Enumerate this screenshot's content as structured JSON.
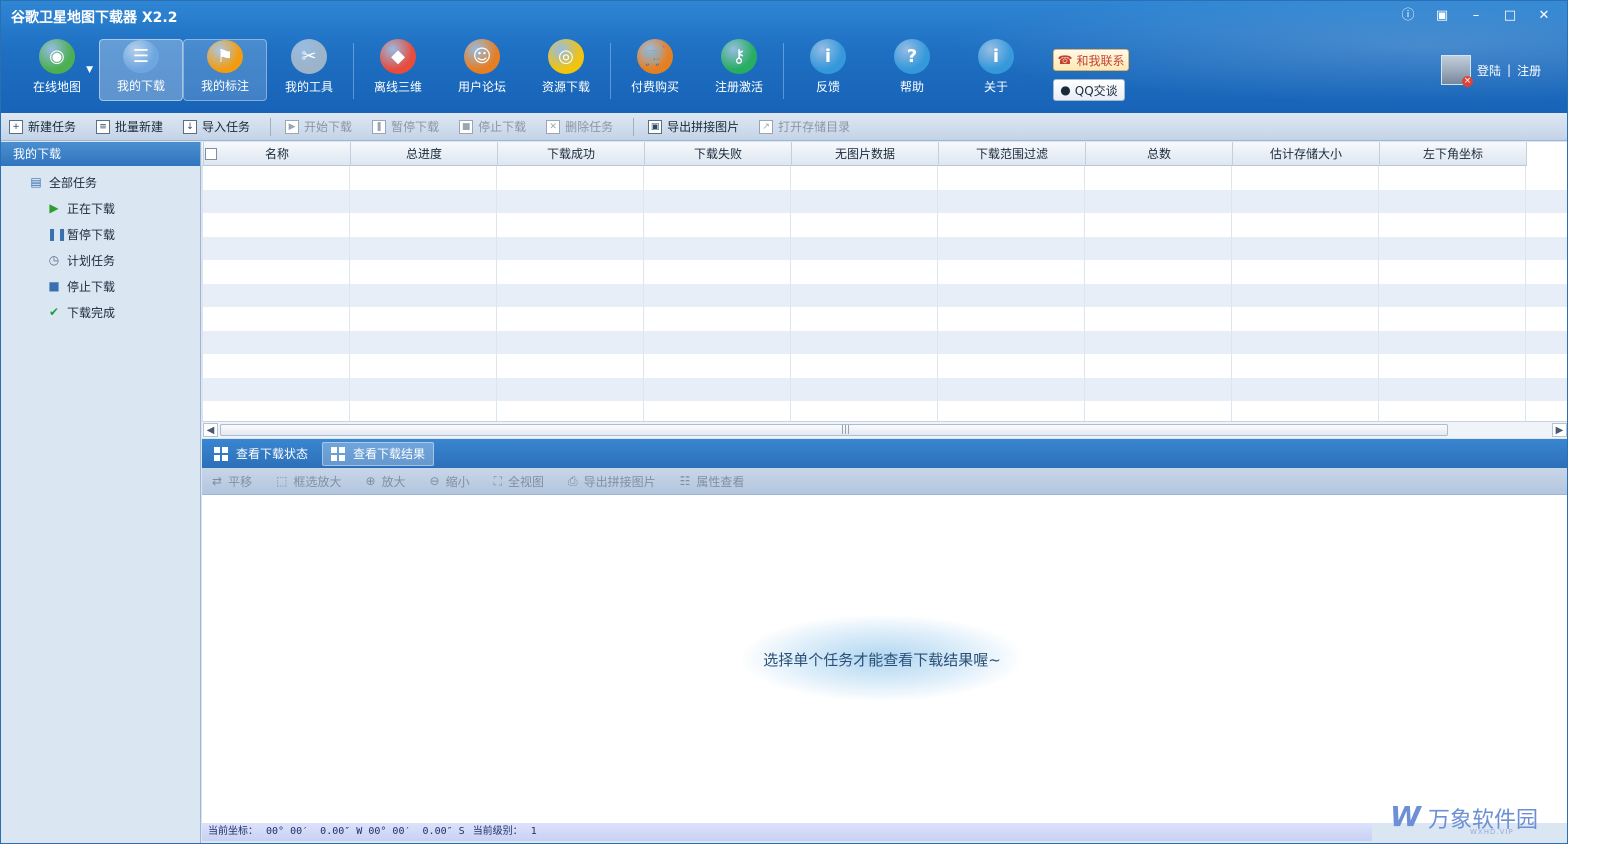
{
  "window": {
    "title": "谷歌卫星地图下载器 X2.2",
    "controls": [
      "ⓘ",
      "▣",
      "–",
      "□",
      "✕"
    ]
  },
  "main_toolbar": [
    {
      "label": "在线地图",
      "icon": "globe-icon",
      "color": "#4caf50"
    },
    {
      "label": "我的下载",
      "icon": "download-list-icon",
      "color": "#6ea6e0"
    },
    {
      "label": "我的标注",
      "icon": "map-pin-icon",
      "color": "#f39c12"
    },
    {
      "label": "我的工具",
      "icon": "tools-icon",
      "color": "#9db3c9"
    },
    {
      "label": "离线三维",
      "icon": "cubes-icon",
      "color": "#e74c3c"
    },
    {
      "label": "用户论坛",
      "icon": "users-icon",
      "color": "#e67e22"
    },
    {
      "label": "资源下载",
      "icon": "resource-globe-icon",
      "color": "#f1c40f"
    },
    {
      "label": "付费购买",
      "icon": "cart-icon",
      "color": "#e67e22"
    },
    {
      "label": "注册激活",
      "icon": "lock-globe-icon",
      "color": "#27ae60"
    },
    {
      "label": "反馈",
      "icon": "feedback-icon",
      "color": "#3498db"
    },
    {
      "label": "帮助",
      "icon": "help-icon",
      "color": "#3498db"
    },
    {
      "label": "关于",
      "icon": "info-icon",
      "color": "#3498db"
    }
  ],
  "contact": {
    "contact_us": "和我联系",
    "qq_chat": "QQ交谈"
  },
  "account": {
    "login": "登陆",
    "separator": "|",
    "register": "注册"
  },
  "task_toolbar": [
    {
      "label": "新建任务",
      "enabled": true,
      "icon": "new-task-icon"
    },
    {
      "label": "批量新建",
      "enabled": true,
      "icon": "batch-new-icon"
    },
    {
      "label": "导入任务",
      "enabled": true,
      "icon": "import-icon"
    },
    {
      "label": "开始下载",
      "enabled": false,
      "icon": "play-icon"
    },
    {
      "label": "暂停下载",
      "enabled": false,
      "icon": "pause-icon"
    },
    {
      "label": "停止下载",
      "enabled": false,
      "icon": "stop-icon"
    },
    {
      "label": "删除任务",
      "enabled": false,
      "icon": "delete-icon"
    },
    {
      "label": "导出拼接图片",
      "enabled": true,
      "icon": "export-image-icon"
    },
    {
      "label": "打开存储目录",
      "enabled": false,
      "icon": "open-folder-icon"
    }
  ],
  "sidebar": {
    "header": "我的下载",
    "root": {
      "label": "全部任务",
      "icon": "list-icon"
    },
    "items": [
      {
        "label": "正在下载",
        "icon": "play-icon",
        "glyph": "▶",
        "color": "#2e9d2e"
      },
      {
        "label": "暂停下载",
        "icon": "pause-icon",
        "glyph": "❚❚",
        "color": "#3a6fb0"
      },
      {
        "label": "计划任务",
        "icon": "clock-icon",
        "glyph": "◷",
        "color": "#5a6e85"
      },
      {
        "label": "停止下载",
        "icon": "stop-icon",
        "glyph": "■",
        "color": "#3a6fb0"
      },
      {
        "label": "下载完成",
        "icon": "check-icon",
        "glyph": "✔",
        "color": "#1f9d3a"
      }
    ]
  },
  "table": {
    "columns": [
      "名称",
      "总进度",
      "下载成功",
      "下载失败",
      "无图片数据",
      "下载范围过滤",
      "总数",
      "估计存储大小",
      "左下角坐标"
    ],
    "rows": []
  },
  "result_tabs": [
    {
      "label": "查看下载状态",
      "selected": false
    },
    {
      "label": "查看下载结果",
      "selected": true
    }
  ],
  "result_toolbar": [
    {
      "label": "平移",
      "icon": "pan-icon",
      "glyph": "⇄"
    },
    {
      "label": "框选放大",
      "icon": "box-zoom-icon",
      "glyph": "⬚"
    },
    {
      "label": "放大",
      "icon": "zoom-in-icon",
      "glyph": "⊕"
    },
    {
      "label": "缩小",
      "icon": "zoom-out-icon",
      "glyph": "⊖"
    },
    {
      "label": "全视图",
      "icon": "full-view-icon",
      "glyph": "⛶"
    },
    {
      "label": "导出拼接图片",
      "icon": "export-image-icon",
      "glyph": "⎙"
    },
    {
      "label": "属性查看",
      "icon": "properties-icon",
      "glyph": "☷"
    }
  ],
  "result_hint": "选择单个任务才能查看下载结果喔~",
  "status": {
    "coord_label": "当前坐标：",
    "coord_value": "00° 00′  0.00″ W 00° 00′  0.00″ S",
    "level_label": "当前级别：",
    "level_value": "1"
  },
  "watermark": {
    "logo": "W",
    "text": "万象软件园",
    "sub": "WXHD.VIP"
  }
}
